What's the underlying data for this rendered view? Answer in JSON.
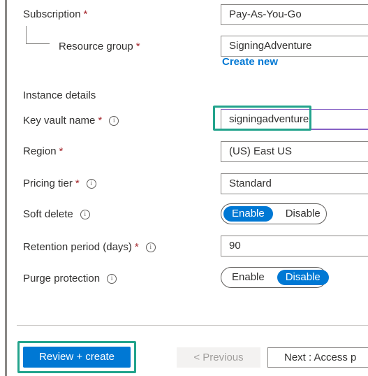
{
  "form": {
    "subscription": {
      "label": "Subscription",
      "required": "*",
      "value": "Pay-As-You-Go"
    },
    "resource_group": {
      "label": "Resource group",
      "required": "*",
      "value": "SigningAdventure",
      "create_new": "Create new"
    },
    "instance_details": "Instance details",
    "key_vault_name": {
      "label": "Key vault name",
      "required": "*",
      "info": "i",
      "value": "signingadventure"
    },
    "region": {
      "label": "Region",
      "required": "*",
      "value": "(US) East US"
    },
    "pricing_tier": {
      "label": "Pricing tier",
      "required": "*",
      "info": "i",
      "value": "Standard"
    },
    "soft_delete": {
      "label": "Soft delete",
      "info": "i",
      "options": [
        "Enable",
        "Disable"
      ],
      "selected": "Enable"
    },
    "retention_period": {
      "label": "Retention period (days)",
      "required": "*",
      "info": "i",
      "value": "90"
    },
    "purge_protection": {
      "label": "Purge protection",
      "info": "i",
      "options": [
        "Enable",
        "Disable"
      ],
      "selected": "Disable"
    }
  },
  "footer": {
    "review_create": "Review + create",
    "previous": "< Previous",
    "next": "Next : Access p"
  },
  "colors": {
    "accent": "#0078d4",
    "required": "#a4262c",
    "highlight": "#22a38c",
    "focus": "#8661c5"
  }
}
